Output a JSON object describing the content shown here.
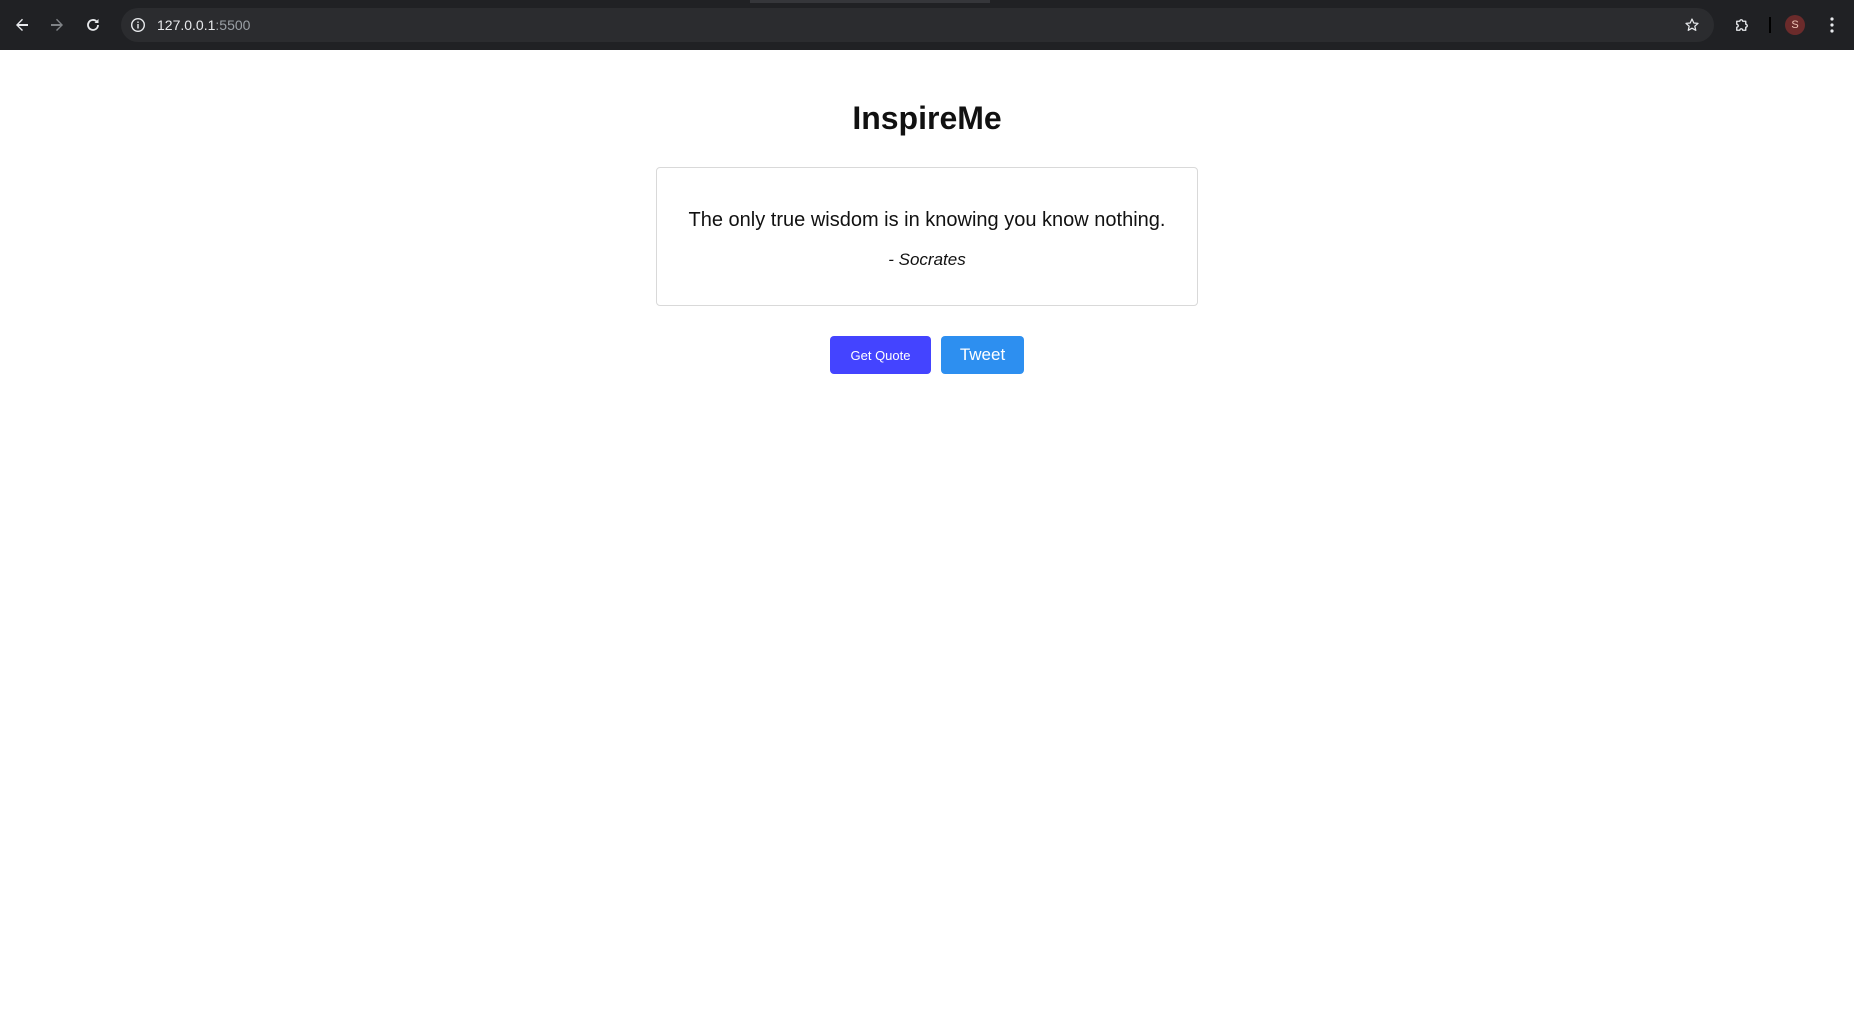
{
  "browser": {
    "url_host": "127.0.0.1",
    "url_port": ":5500",
    "avatar_initial": "S",
    "icons": {
      "back": "back-arrow-icon",
      "forward": "forward-arrow-icon",
      "reload": "reload-icon",
      "site_info": "info-icon",
      "bookmark": "star-icon",
      "extensions": "puzzle-icon",
      "menu": "kebab-menu-icon"
    }
  },
  "app": {
    "title": "InspireMe",
    "quote": {
      "text": "The only true wisdom is in knowing you know nothing.",
      "author": "- Socrates"
    },
    "buttons": {
      "get_quote": "Get Quote",
      "tweet": "Tweet"
    }
  },
  "colors": {
    "browser_bar": "#202124",
    "get_quote_button": "#4444ff",
    "tweet_button": "#2d8ff0",
    "card_border": "#d9d9d9"
  }
}
